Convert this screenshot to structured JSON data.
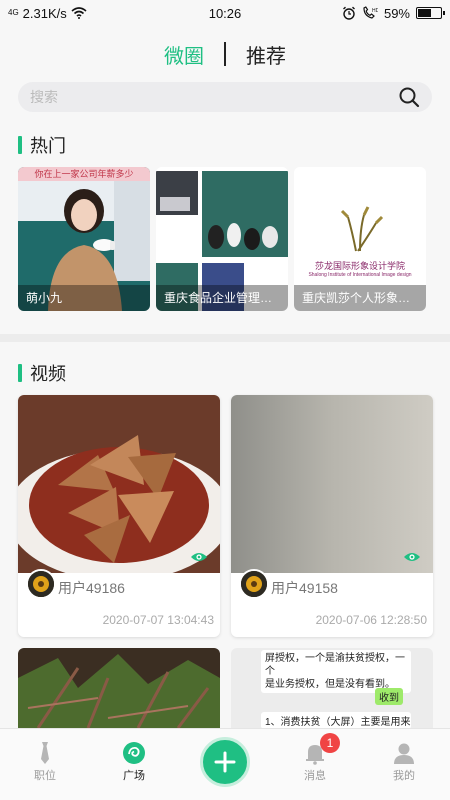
{
  "status_bar": {
    "network": "4G",
    "speed": "2.31K/s",
    "time": "10:26",
    "battery": "59%",
    "battery_level": 0.59
  },
  "top_tabs": {
    "active": "微圈",
    "other": "推荐"
  },
  "search": {
    "placeholder": "搜索"
  },
  "hot": {
    "title": "热门",
    "cards": [
      {
        "caption": "萌小九",
        "banner": "你在上一家公司年薪多少"
      },
      {
        "caption": "重庆食品企业管理咨..."
      },
      {
        "caption": "重庆凯莎个人形象设...",
        "logo_title": "莎龙国际形象设计学院",
        "logo_subtitle": "Shalong Institute of International Image design"
      }
    ]
  },
  "video": {
    "title": "视频",
    "cards": [
      {
        "user": "用户49186",
        "date": "2020-07-07 13:04:43"
      },
      {
        "user": "用户49158",
        "date": "2020-07-06 12:28:50"
      }
    ],
    "chat_preview": {
      "line1": "屏授权，一个是渝扶贫授权，一个",
      "line2": "是业务授权，但是没有看到。",
      "reply": "收到",
      "line3": "1、消费扶贫（大屏）主要是用来电"
    }
  },
  "bottom_nav": {
    "items": [
      {
        "label": "职位",
        "icon": "tie-icon"
      },
      {
        "label": "广场",
        "icon": "plaza-icon"
      },
      {
        "label": "消息",
        "icon": "bell-icon"
      },
      {
        "label": "我的",
        "icon": "person-icon"
      }
    ],
    "badge": "1"
  },
  "colors": {
    "accent": "#1fbf83",
    "badge": "#f04444"
  }
}
